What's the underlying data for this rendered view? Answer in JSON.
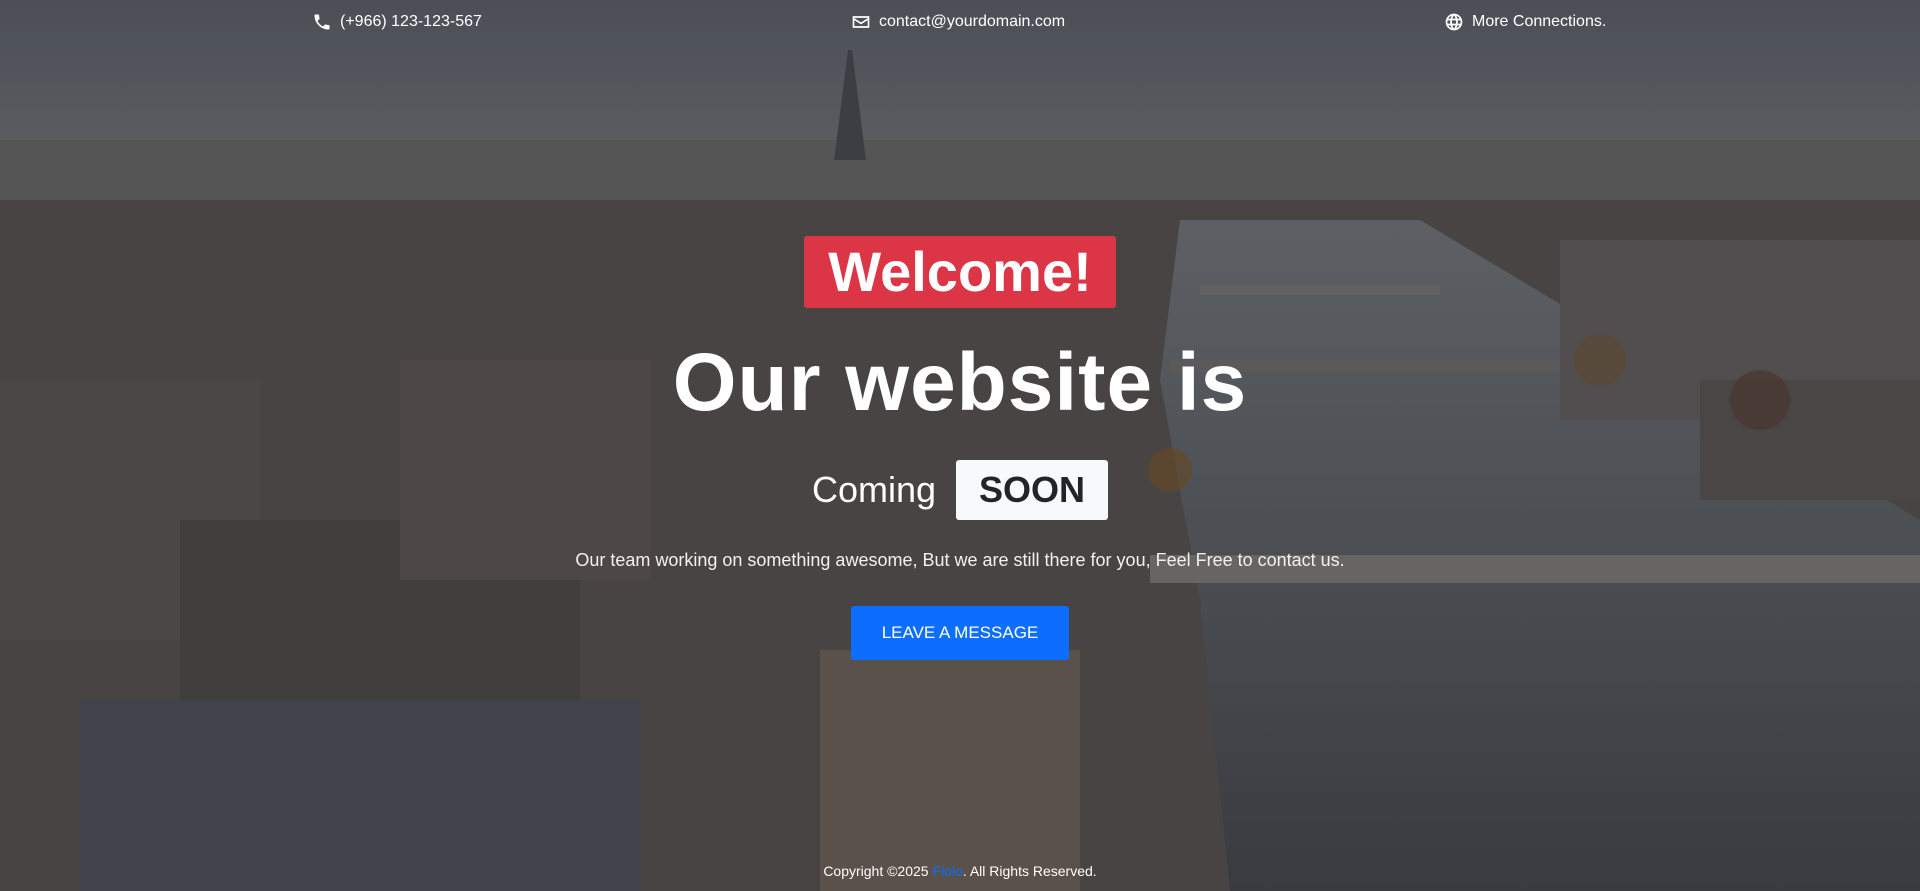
{
  "topbar": {
    "phone": {
      "icon": "phone-icon",
      "text": "(+966) 123-123-567"
    },
    "email": {
      "icon": "envelope-icon",
      "text": "contact@yourdomain.com"
    },
    "more": {
      "icon": "globe-icon",
      "text": "More Connections."
    }
  },
  "hero": {
    "badge": "Welcome!",
    "headline": "Our website is",
    "coming": "Coming",
    "soon": "SOON",
    "tagline": "Our team working on something awesome, But we are still there for you, Feel Free to contact us.",
    "cta_label": "LEAVE A MESSAGE"
  },
  "footer": {
    "prefix": "Copyright ©2025 ",
    "brand": "Flolo",
    "suffix": ". All Rights Reserved."
  },
  "colors": {
    "badge_red": "#dc3545",
    "cta_blue": "#0d6efd",
    "soon_bg": "#f8f9fa"
  }
}
